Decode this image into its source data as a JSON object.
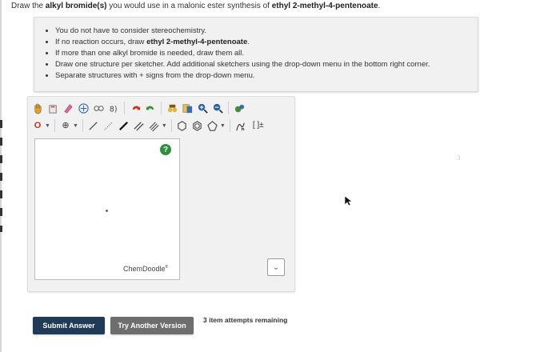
{
  "question": {
    "prefix": "Draw the ",
    "bold1": "alkyl bromide(s)",
    "middle": " you would use in a malonic ester synthesis of ",
    "bold2": "ethyl 2-methyl-4-pentenoate",
    "suffix": "."
  },
  "instructions": {
    "item1": "You do not have to consider stereochemistry.",
    "item2_prefix": "If no reaction occurs, draw ",
    "item2_bold": "ethyl 2-methyl-4-pentenoate",
    "item2_suffix": ".",
    "item3": "If more than one alkyl bromide is needed, draw them all.",
    "item4": "Draw one structure per sketcher. Add additional sketchers using the drop-down menu in the bottom right corner.",
    "item5": "Separate structures with + signs from the drop-down menu."
  },
  "toolbar": {
    "atom_label": "O",
    "charge_label": "⊕",
    "bracket_label": "[ ]±"
  },
  "sketcher": {
    "help": "?",
    "brand": "ChemDoodle",
    "brand_mark": "®"
  },
  "buttons": {
    "submit": "Submit Answer",
    "try_another": "Try Another Version"
  },
  "attempts": "3 item attempts remaining",
  "faint_label": "3",
  "colors": {
    "submit_bg": "#1f3b57",
    "try_bg": "#6e6e6e",
    "help_badge": "#2f8f3a"
  }
}
